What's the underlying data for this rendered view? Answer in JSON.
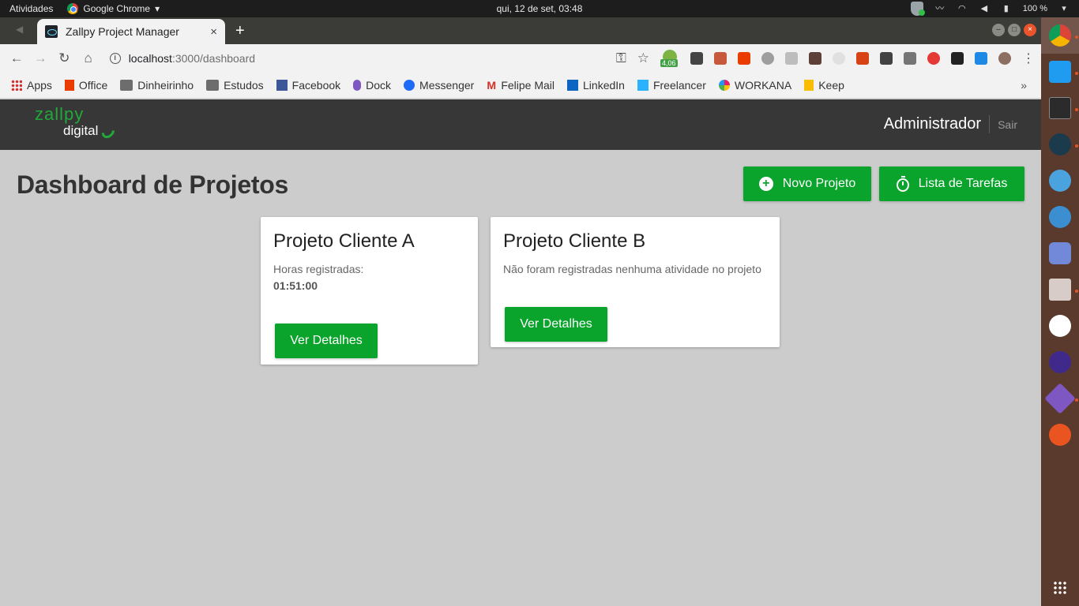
{
  "system": {
    "activities": "Atividades",
    "app_name": "Google Chrome",
    "clock": "qui, 12 de set, 03:48",
    "battery": "100 %"
  },
  "browser": {
    "tab_title": "Zallpy Project Manager",
    "tab_close": "×",
    "new_tab": "+",
    "url_host": "localhost",
    "url_path": ":3000/dashboard",
    "ext_badge": "4,06",
    "bookmarks": [
      {
        "label": "Apps",
        "icon": "apps-grid-icon"
      },
      {
        "label": "Office",
        "icon": "office-icon"
      },
      {
        "label": "Dinheirinho",
        "icon": "folder-icon"
      },
      {
        "label": "Estudos",
        "icon": "folder-icon"
      },
      {
        "label": "Facebook",
        "icon": "facebook-icon"
      },
      {
        "label": "Dock",
        "icon": "dock-icon"
      },
      {
        "label": "Messenger",
        "icon": "messenger-icon"
      },
      {
        "label": "Felipe Mail",
        "icon": "gmail-icon"
      },
      {
        "label": "LinkedIn",
        "icon": "linkedin-icon"
      },
      {
        "label": "Freelancer",
        "icon": "freelancer-icon"
      },
      {
        "label": "WORKANA",
        "icon": "workana-icon"
      },
      {
        "label": "Keep",
        "icon": "keep-icon"
      }
    ],
    "bookmarks_more": "»"
  },
  "app": {
    "logo_line1": "zallpy",
    "logo_line2": "digital",
    "user_name": "Administrador",
    "logout_label": "Sair",
    "page_title": "Dashboard de Projetos",
    "new_project_label": "Novo Projeto",
    "tasks_label": "Lista de Tarefas",
    "accent_color": "#0aa32b",
    "projects": [
      {
        "name": "Projeto Cliente A",
        "hours_label": "Horas registradas:",
        "hours_value": "01:51:00",
        "button_label": "Ver Detalhes"
      },
      {
        "name": "Projeto Cliente B",
        "empty_message": "Não foram registradas nenhuma atividade no projeto",
        "button_label": "Ver Detalhes"
      }
    ]
  }
}
